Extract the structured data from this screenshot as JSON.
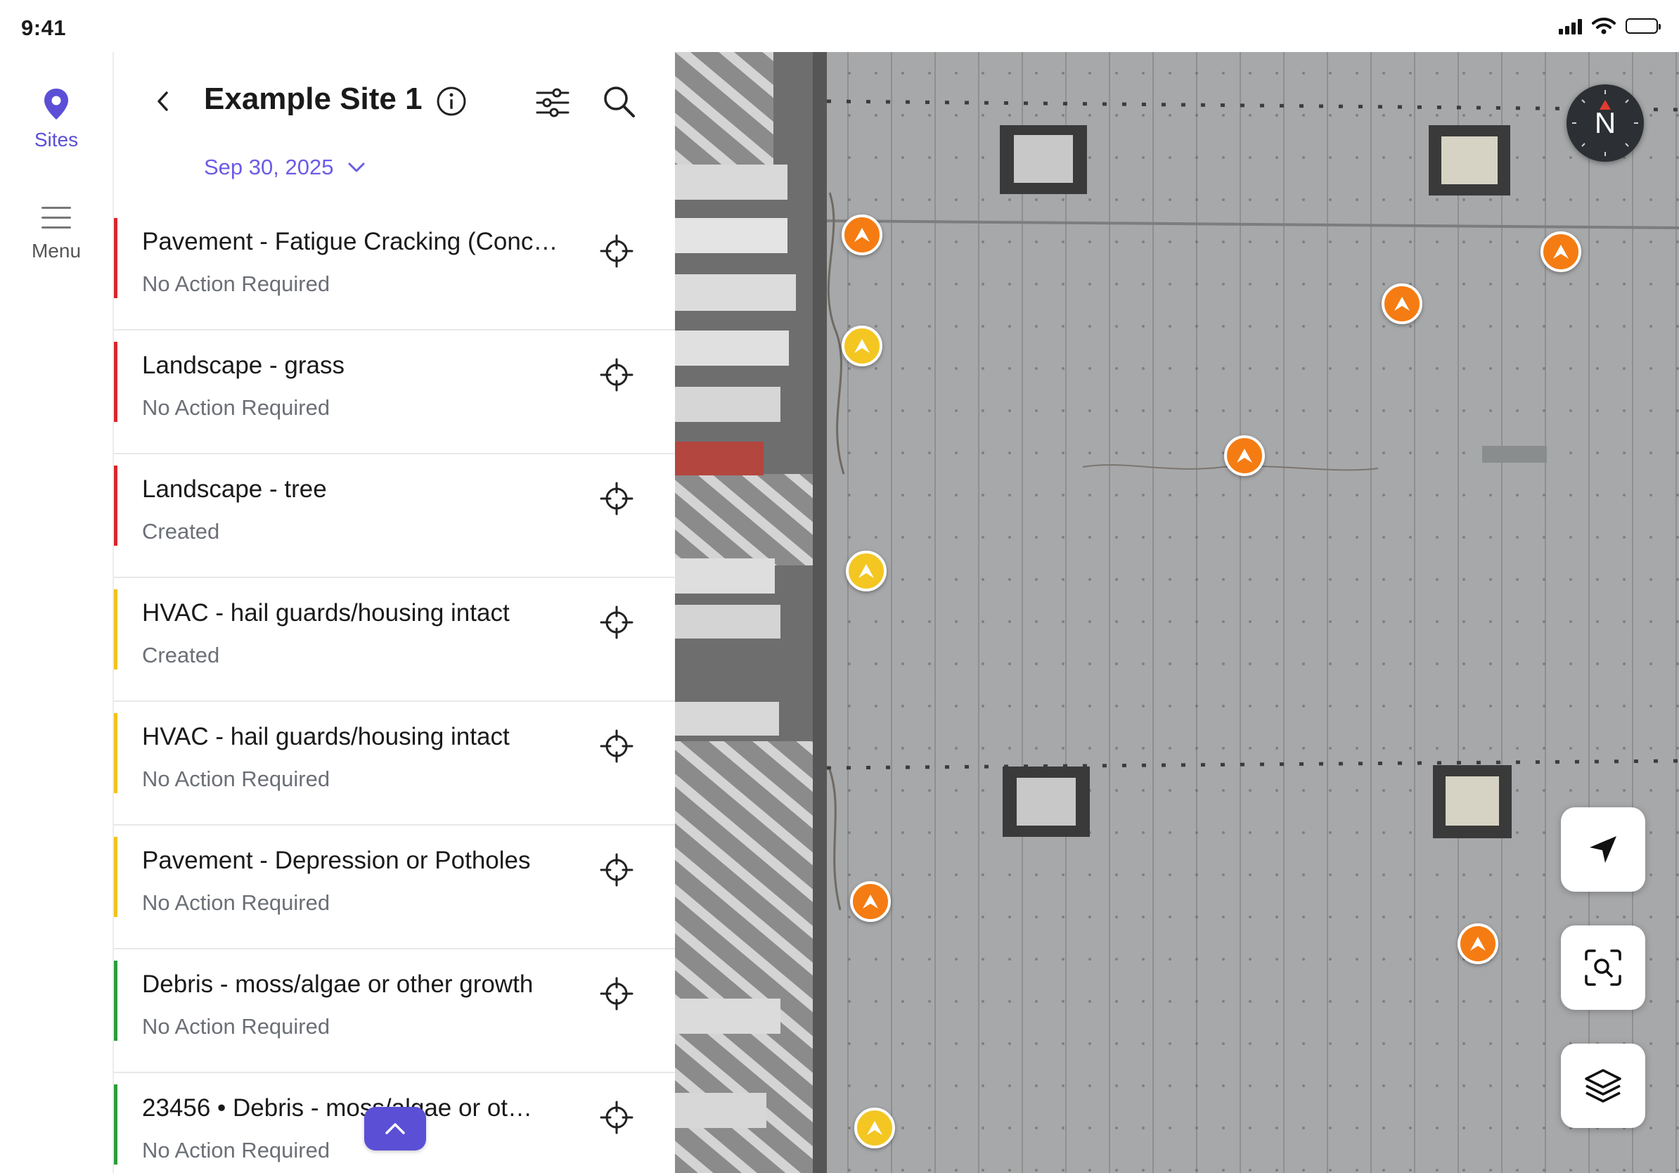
{
  "status_bar": {
    "time": "9:41"
  },
  "rail": {
    "items": [
      {
        "label": "Sites",
        "icon": "location-pin-icon",
        "active": true
      },
      {
        "label": "Menu",
        "icon": "hamburger-menu-icon",
        "active": false
      }
    ]
  },
  "header": {
    "title": "Example Site 1",
    "date": "Sep 30, 2025"
  },
  "colors": {
    "accent": "#5b4fd6",
    "date": "#6b5ce7",
    "severity_red": "#d9262b",
    "severity_yellow": "#f2c21b",
    "severity_green": "#2a9d3a",
    "marker_orange": "#f57c12",
    "marker_yellow": "#f3c622"
  },
  "issues": [
    {
      "title": "Pavement - Fatigue Cracking (Conc…",
      "status": "No Action Required",
      "severity": "red"
    },
    {
      "title": "Landscape - grass",
      "status": "No Action Required",
      "severity": "red"
    },
    {
      "title": "Landscape - tree",
      "status": "Created",
      "severity": "red"
    },
    {
      "title": "HVAC - hail guards/housing intact",
      "status": "Created",
      "severity": "yellow"
    },
    {
      "title": "HVAC - hail guards/housing intact",
      "status": "No Action Required",
      "severity": "yellow"
    },
    {
      "title": "Pavement - Depression or Potholes",
      "status": "No Action Required",
      "severity": "yellow"
    },
    {
      "title": "Debris - moss/algae or other growth",
      "status": "No Action Required",
      "severity": "green"
    },
    {
      "title": "23456 • Debris - moss/algae or ot…",
      "status": "No Action Required",
      "severity": "green"
    }
  ],
  "map": {
    "compass_label": "N",
    "markers": [
      {
        "color": "orange"
      },
      {
        "color": "yellow"
      },
      {
        "color": "orange"
      },
      {
        "color": "orange"
      },
      {
        "color": "orange"
      },
      {
        "color": "yellow"
      },
      {
        "color": "orange"
      },
      {
        "color": "orange"
      },
      {
        "color": "yellow"
      }
    ],
    "buttons": [
      "navigate-arrow-icon",
      "zoom-search-icon",
      "layers-icon"
    ]
  }
}
